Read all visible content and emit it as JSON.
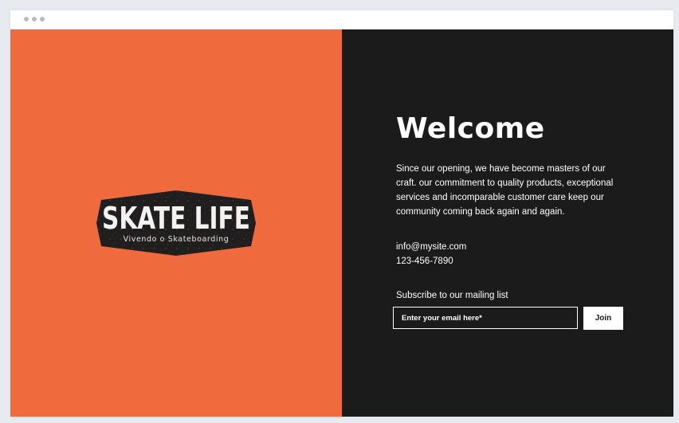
{
  "colors": {
    "page_background": "#e7ebf0",
    "left_panel": "#ef6b3e",
    "right_panel": "#1b1b1b",
    "text": "#ffffff",
    "button_bg": "#ffffff",
    "button_text": "#1b1b1b"
  },
  "logo": {
    "title": "SKATE LIFE",
    "tagline": "Vivendo o Skateboarding"
  },
  "main": {
    "heading": "Welcome",
    "intro": "Since our opening, we have become masters of our craft. our commitment to quality products, exceptional services and incomparable customer care keep our community coming back again and again.",
    "email": "info@mysite.com",
    "phone": "123-456-7890"
  },
  "subscribe": {
    "label": "Subscribe to our mailing list",
    "placeholder": "Enter your email here*",
    "button_label": "Join"
  }
}
